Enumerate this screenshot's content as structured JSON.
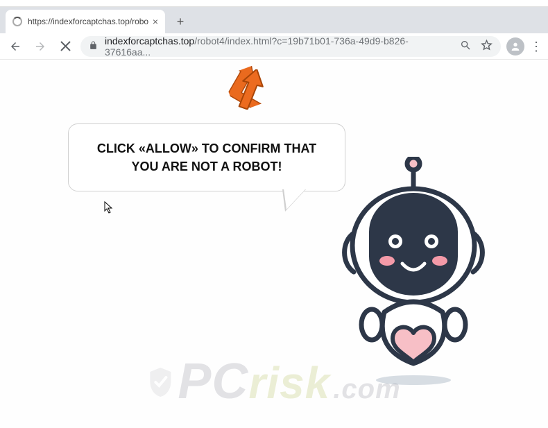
{
  "window": {
    "tab_title": "https://indexforcaptchas.top/robo"
  },
  "address_bar": {
    "host": "indexforcaptchas.top",
    "path": "/robot4/index.html?c=19b71b01-736a-49d9-b826-37616aa..."
  },
  "page": {
    "bubble_text": "CLICK «ALLOW» TO CONFIRM THAT YOU ARE NOT A ROBOT!"
  },
  "watermark": {
    "part1": "PC",
    "part2": "risk",
    "part3": ".com"
  },
  "colors": {
    "robot_body": "#344054",
    "robot_mouth_bg": "#f7bfc6",
    "robot_heart": "#f7bfc6",
    "arrow": "#ea6a1e"
  }
}
